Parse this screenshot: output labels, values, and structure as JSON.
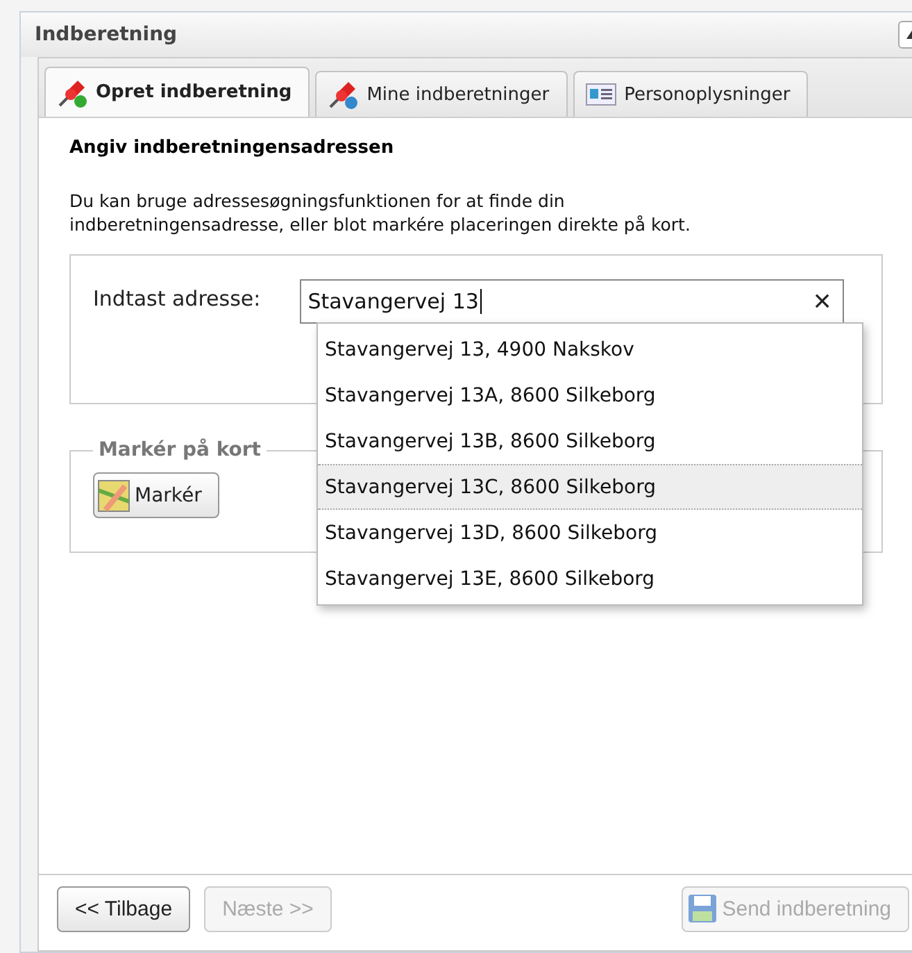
{
  "window": {
    "title": "Indberetning"
  },
  "tabs": [
    {
      "label": "Opret indberetning",
      "selected": true
    },
    {
      "label": "Mine indberetninger",
      "selected": false
    },
    {
      "label": "Personoplysninger",
      "selected": false
    }
  ],
  "heading": "Angiv indberetningensadressen",
  "description": "Du kan bruge adressesøgningsfunktionen for at finde din indberetningensadresse, eller blot markére placeringen direkte på kort.",
  "address": {
    "label": "Indtast adresse:",
    "value": "Stavangervej 13",
    "clear": "×",
    "suggestions": [
      {
        "text": "Stavangervej 13, 4900 Nakskov",
        "selected": false
      },
      {
        "text": "Stavangervej 13A, 8600 Silkeborg",
        "selected": false
      },
      {
        "text": "Stavangervej 13B, 8600 Silkeborg",
        "selected": false
      },
      {
        "text": "Stavangervej 13C, 8600 Silkeborg",
        "selected": true
      },
      {
        "text": "Stavangervej 13D, 8600 Silkeborg",
        "selected": false
      },
      {
        "text": "Stavangervej 13E, 8600 Silkeborg",
        "selected": false
      }
    ]
  },
  "map": {
    "legend": "Markér på kort",
    "button": "Markér"
  },
  "footer": [
    {
      "label": "<< Tilbage",
      "disabled": false
    },
    {
      "label": "Næste >>",
      "disabled": true
    },
    {
      "label": "Send indberetning",
      "disabled": true
    }
  ]
}
